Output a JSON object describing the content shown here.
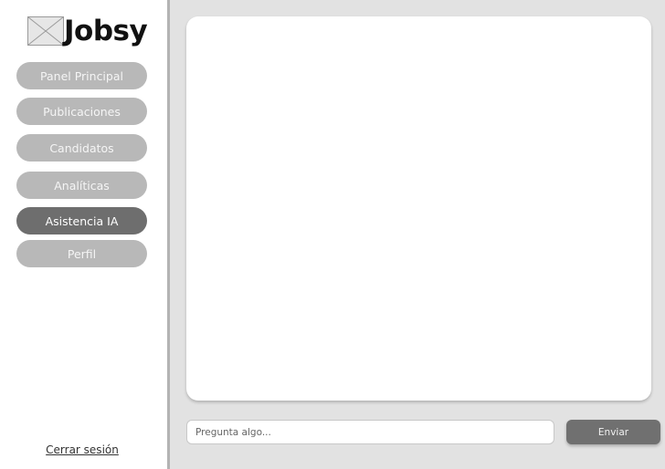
{
  "app": {
    "logo_text": "Jobsy"
  },
  "sidebar": {
    "items": [
      {
        "label": "Panel Principal",
        "active": false
      },
      {
        "label": "Publicaciones",
        "active": false
      },
      {
        "label": "Candidatos",
        "active": false
      },
      {
        "label": "Analíticas",
        "active": false
      },
      {
        "label": "Asistencia IA",
        "active": true
      },
      {
        "label": "Perfil",
        "active": false
      }
    ],
    "logout_label": "Cerrar sesión"
  },
  "chat": {
    "input_placeholder": "Pregunta algo...",
    "input_value": "",
    "send_label": "Enviar"
  },
  "colors": {
    "nav_inactive": "#b8b8b8",
    "nav_active": "#6e6e6e",
    "send_button": "#707070",
    "background": "#e2e2e2"
  }
}
